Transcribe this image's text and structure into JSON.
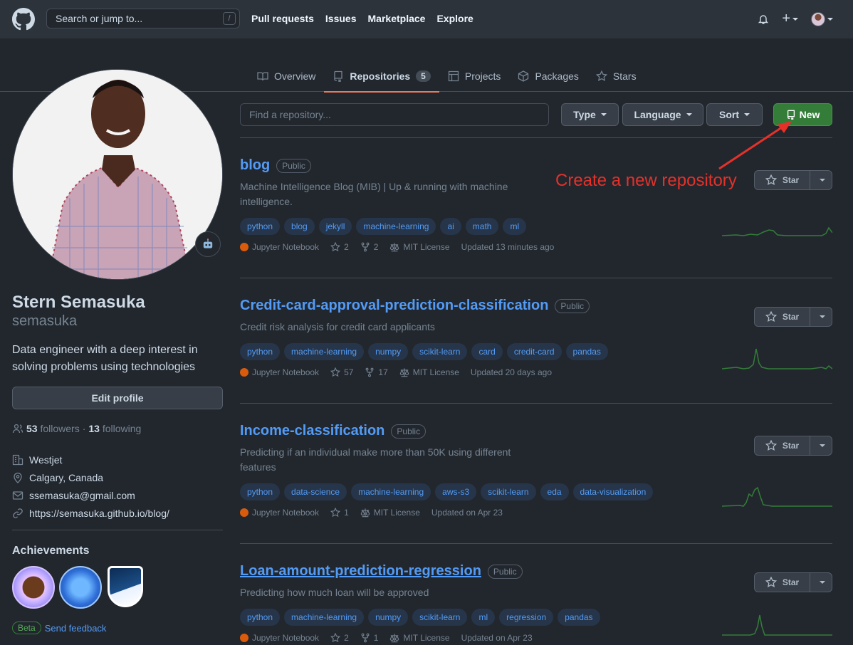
{
  "header": {
    "search_placeholder": "Search or jump to...",
    "search_shortcut": "/",
    "nav": [
      "Pull requests",
      "Issues",
      "Marketplace",
      "Explore"
    ],
    "plus_label": "+"
  },
  "tabs": [
    {
      "label": "Overview",
      "icon": "book-icon"
    },
    {
      "label": "Repositories",
      "icon": "repo-icon",
      "count": "5",
      "active": true
    },
    {
      "label": "Projects",
      "icon": "table-icon"
    },
    {
      "label": "Packages",
      "icon": "package-icon"
    },
    {
      "label": "Stars",
      "icon": "star-icon"
    }
  ],
  "profile": {
    "full_name": "Stern Semasuka",
    "username": "semasuka",
    "bio": "Data engineer with a deep interest in solving problems using technologies",
    "edit_label": "Edit profile",
    "followers_count": "53",
    "followers_label": "followers",
    "separator": "·",
    "following_count": "13",
    "following_label": "following",
    "company": "Westjet",
    "location": "Calgary, Canada",
    "email": "ssemasuka@gmail.com",
    "website": "https://semasuka.github.io/blog/",
    "achievements_title": "Achievements",
    "beta_label": "Beta",
    "feedback_label": "Send feedback"
  },
  "toolbar": {
    "find_placeholder": "Find a repository...",
    "type_label": "Type",
    "language_label": "Language",
    "sort_label": "Sort",
    "new_label": "New"
  },
  "annotation": {
    "text": "Create a new repository",
    "color": "#e5312a"
  },
  "repos": [
    {
      "name": "blog",
      "visibility": "Public",
      "description": "Machine Intelligence Blog (MIB) | Up & running with machine intelligence.",
      "topics": [
        "python",
        "blog",
        "jekyll",
        "machine-learning",
        "ai",
        "math",
        "ml"
      ],
      "language": "Jupyter Notebook",
      "stars": "2",
      "forks": "2",
      "license": "MIT License",
      "updated": "Updated 13 minutes ago",
      "star_label": "Star"
    },
    {
      "name": "Credit-card-approval-prediction-classification",
      "visibility": "Public",
      "description": "Credit risk analysis for credit card applicants",
      "topics": [
        "python",
        "machine-learning",
        "numpy",
        "scikit-learn",
        "card",
        "credit-card",
        "pandas"
      ],
      "language": "Jupyter Notebook",
      "stars": "57",
      "forks": "17",
      "license": "MIT License",
      "updated": "Updated 20 days ago",
      "star_label": "Star"
    },
    {
      "name": "Income-classification",
      "visibility": "Public",
      "description": "Predicting if an individual make more than 50K using different features",
      "topics": [
        "python",
        "data-science",
        "machine-learning",
        "aws-s3",
        "scikit-learn",
        "eda",
        "data-visualization"
      ],
      "language": "Jupyter Notebook",
      "stars": "1",
      "license": "MIT License",
      "updated": "Updated on Apr 23",
      "star_label": "Star"
    },
    {
      "name": "Loan-amount-prediction-regression",
      "visibility": "Public",
      "description": "Predicting how much loan will be approved",
      "topics": [
        "python",
        "machine-learning",
        "numpy",
        "scikit-learn",
        "ml",
        "regression",
        "pandas"
      ],
      "language": "Jupyter Notebook",
      "stars": "2",
      "forks": "1",
      "license": "MIT License",
      "updated": "Updated on Apr 23",
      "star_label": "Star"
    }
  ],
  "colors": {
    "accent_green": "#347d39",
    "link_blue": "#539bf5",
    "tab_underline": "#ec775c",
    "language_jupyter": "#da5b0b"
  }
}
